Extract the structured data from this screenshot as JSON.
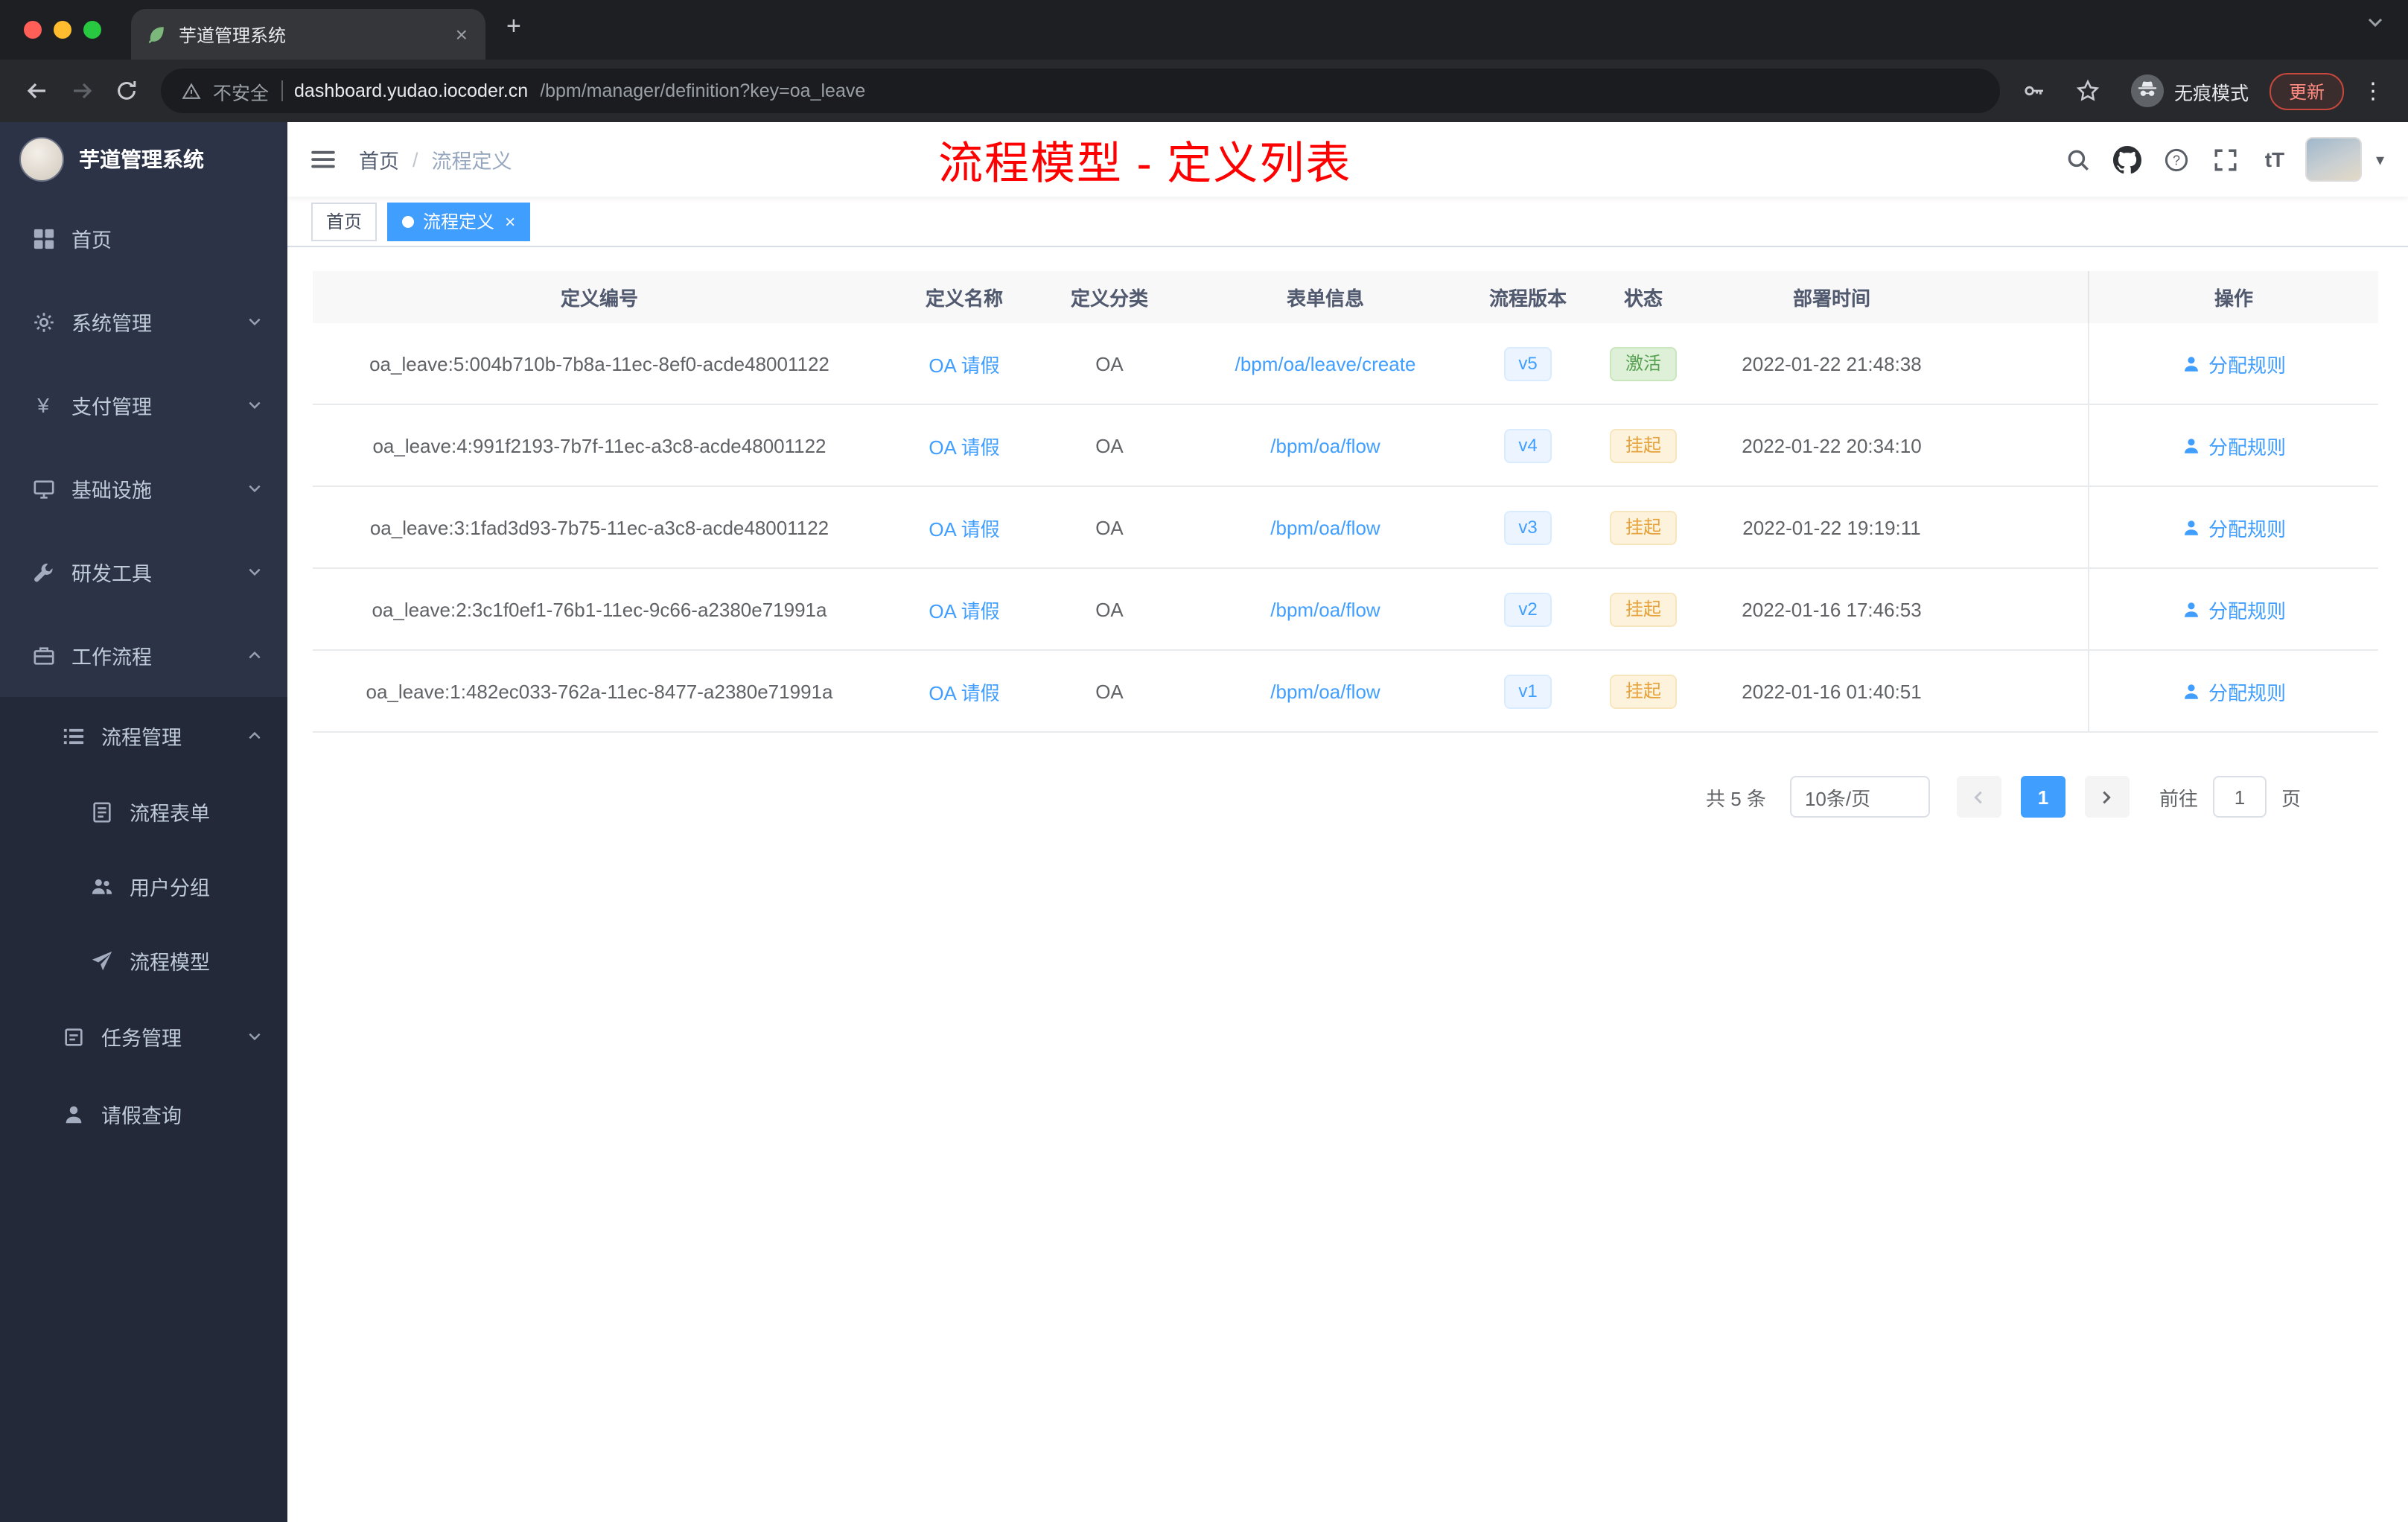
{
  "browser": {
    "tab_title": "芋道管理系统",
    "security_label": "不安全",
    "url_domain": "dashboard.yudao.iocoder.cn",
    "url_path": "/bpm/manager/definition?key=oa_leave",
    "incognito_label": "无痕模式",
    "update_label": "更新"
  },
  "sidebar": {
    "app_title": "芋道管理系统",
    "items": [
      {
        "id": "home",
        "label": "首页",
        "icon": "dashboard-icon",
        "level": 1,
        "chevron": null,
        "sub": false
      },
      {
        "id": "system",
        "label": "系统管理",
        "icon": "gear-icon",
        "level": 1,
        "chevron": "down",
        "sub": false
      },
      {
        "id": "payment",
        "label": "支付管理",
        "icon": "yen-icon",
        "level": 1,
        "chevron": "down",
        "sub": false
      },
      {
        "id": "infra",
        "label": "基础设施",
        "icon": "infra-icon",
        "level": 1,
        "chevron": "down",
        "sub": false
      },
      {
        "id": "devtools",
        "label": "研发工具",
        "icon": "tool-icon",
        "level": 1,
        "chevron": "down",
        "sub": false
      },
      {
        "id": "workflow",
        "label": "工作流程",
        "icon": "workflow-icon",
        "level": 1,
        "chevron": "up",
        "sub": false
      },
      {
        "id": "process-manage",
        "label": "流程管理",
        "icon": "list-icon",
        "level": 2,
        "chevron": "up",
        "sub": true
      },
      {
        "id": "process-form",
        "label": "流程表单",
        "icon": "form-icon",
        "level": 3,
        "chevron": null,
        "sub": true
      },
      {
        "id": "user-group",
        "label": "用户分组",
        "icon": "group-icon",
        "level": 3,
        "chevron": null,
        "sub": true
      },
      {
        "id": "process-model",
        "label": "流程模型",
        "icon": "model-icon",
        "level": 3,
        "chevron": null,
        "sub": true
      },
      {
        "id": "task-manage",
        "label": "任务管理",
        "icon": "task-icon",
        "level": 2,
        "chevron": "down",
        "sub": true
      },
      {
        "id": "leave-query",
        "label": "请假查询",
        "icon": "person-icon",
        "level": 2,
        "chevron": null,
        "sub": true
      }
    ]
  },
  "header": {
    "breadcrumb_home": "首页",
    "breadcrumb_sep": "/",
    "breadcrumb_current": "流程定义",
    "annotation": "流程模型 - 定义列表",
    "fontsize_label": "tT"
  },
  "tags": {
    "home": "首页",
    "active": "流程定义"
  },
  "table": {
    "columns": [
      "定义编号",
      "定义名称",
      "定义分类",
      "表单信息",
      "流程版本",
      "状态",
      "部署时间",
      "操作"
    ],
    "rows": [
      {
        "id": "oa_leave:5:004b710b-7b8a-11ec-8ef0-acde48001122",
        "name": "OA 请假",
        "category": "OA",
        "form": "/bpm/oa/leave/create",
        "version": "v5",
        "status": "激活",
        "status_type": "success",
        "time": "2022-01-22 21:48:38",
        "action": "分配规则"
      },
      {
        "id": "oa_leave:4:991f2193-7b7f-11ec-a3c8-acde48001122",
        "name": "OA 请假",
        "category": "OA",
        "form": "/bpm/oa/flow",
        "version": "v4",
        "status": "挂起",
        "status_type": "warning",
        "time": "2022-01-22 20:34:10",
        "action": "分配规则"
      },
      {
        "id": "oa_leave:3:1fad3d93-7b75-11ec-a3c8-acde48001122",
        "name": "OA 请假",
        "category": "OA",
        "form": "/bpm/oa/flow",
        "version": "v3",
        "status": "挂起",
        "status_type": "warning",
        "time": "2022-01-22 19:19:11",
        "action": "分配规则"
      },
      {
        "id": "oa_leave:2:3c1f0ef1-76b1-11ec-9c66-a2380e71991a",
        "name": "OA 请假",
        "category": "OA",
        "form": "/bpm/oa/flow",
        "version": "v2",
        "status": "挂起",
        "status_type": "warning",
        "time": "2022-01-16 17:46:53",
        "action": "分配规则"
      },
      {
        "id": "oa_leave:1:482ec033-762a-11ec-8477-a2380e71991a",
        "name": "OA 请假",
        "category": "OA",
        "form": "/bpm/oa/flow",
        "version": "v1",
        "status": "挂起",
        "status_type": "warning",
        "time": "2022-01-16 01:40:51",
        "action": "分配规则"
      }
    ]
  },
  "pagination": {
    "total_text": "共 5 条",
    "page_size": "10条/页",
    "current_page": "1",
    "goto_label": "前往",
    "goto_value": "1",
    "unit_label": "页"
  }
}
